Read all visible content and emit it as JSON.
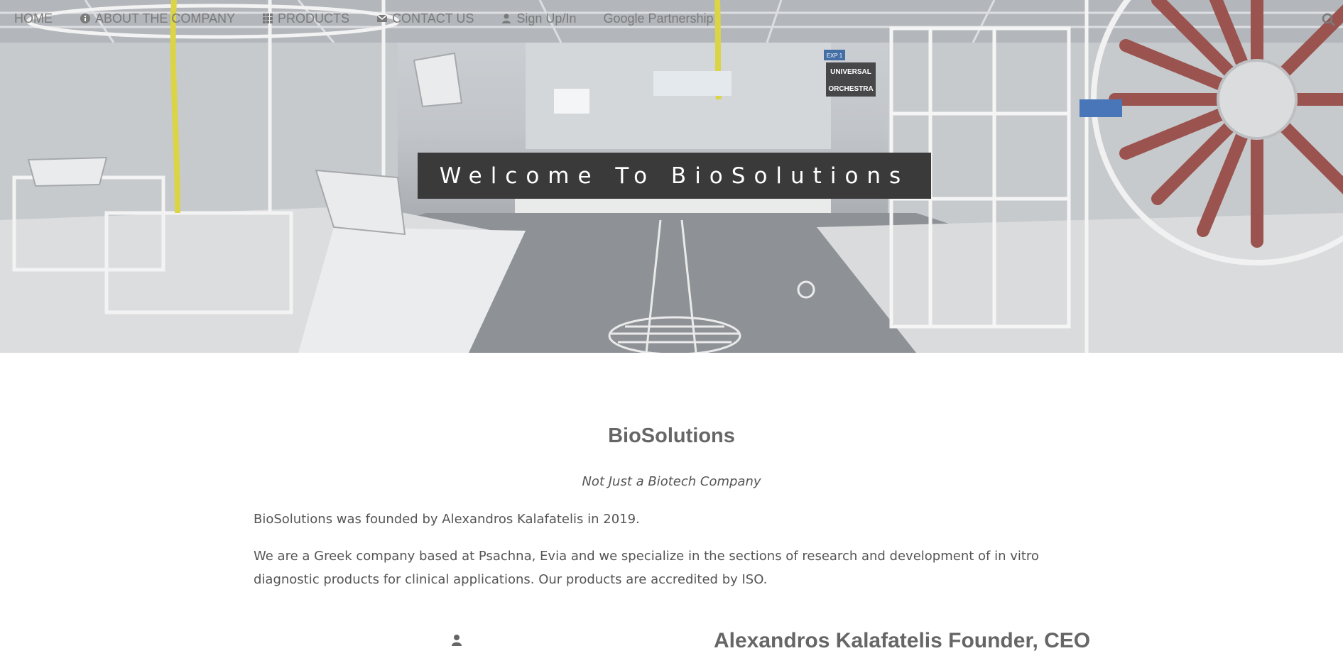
{
  "nav": {
    "items": [
      {
        "label": "HOME",
        "icon": ""
      },
      {
        "label": "ABOUT THE COMPANY",
        "icon": "info-icon"
      },
      {
        "label": "PRODUCTS",
        "icon": "grid-icon"
      },
      {
        "label": "CONTACT US",
        "icon": "envelope-icon"
      },
      {
        "label": "Sign Up/In",
        "icon": "user-icon"
      },
      {
        "label": "Google Partnership",
        "icon": ""
      }
    ],
    "search_icon": "search-icon"
  },
  "hero": {
    "banner_text": "Welcome To BioSolutions",
    "signs": {
      "sign1": "EXP 1",
      "sign2": "UNIVERSAL",
      "sign3": "ORCHESTRA"
    }
  },
  "main": {
    "title": "BioSolutions",
    "tagline": "Not Just a Biotech Company",
    "paragraph1": "BioSolutions was founded by Alexandros Kalafatelis in 2019.",
    "paragraph2": "We are a Greek company based at Psachna, Evia and we specialize in the sections of research and development of in vitro diagnostic products for clinical applications. Our products are accredited by ISO.",
    "founder": {
      "icon": "user-icon",
      "name": "Alexandros Kalafatelis Founder, CEO"
    }
  },
  "colors": {
    "banner_bg": "#3a3a3a",
    "text": "#666666",
    "nav_text": "#7a7a7a"
  }
}
